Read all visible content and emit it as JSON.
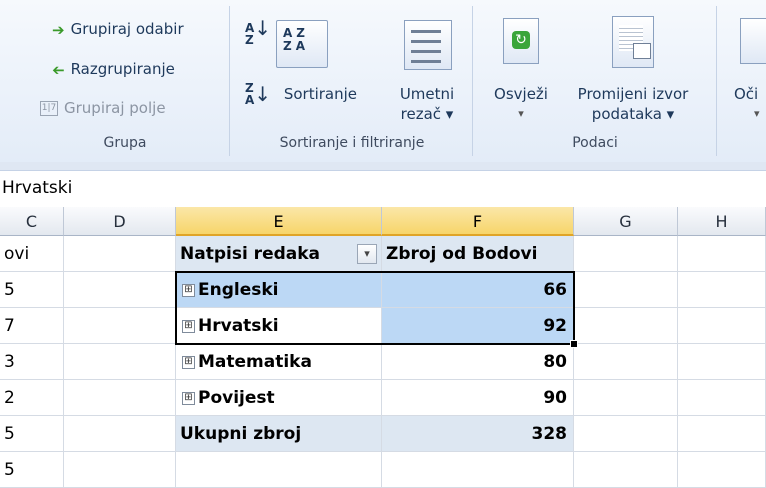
{
  "ribbon": {
    "grupa": {
      "group_selection": "Grupiraj odabir",
      "ungroup": "Razgrupiranje",
      "group_field": "Grupiraj polje",
      "label": "Grupa"
    },
    "sort": {
      "sort_label": "Sortiranje",
      "slicer_line1": "Umetni",
      "slicer_line2": "rezač ▾",
      "label": "Sortiranje i filtriranje"
    },
    "data": {
      "refresh": "Osvježi",
      "refresh_arrow": "▾",
      "change_source_line1": "Promijeni izvor",
      "change_source_line2": "podataka ▾",
      "label": "Podaci"
    },
    "partial": {
      "clear_label": "Oči",
      "clear_arrow": "▾"
    }
  },
  "formula_bar": {
    "value": "Hrvatski"
  },
  "columns": [
    "C",
    "D",
    "E",
    "F",
    "G",
    "H"
  ],
  "left_column_fragments": [
    "ovi",
    "5",
    "7",
    "3",
    "2",
    "5",
    "5"
  ],
  "pivot": {
    "header_rows": "Natpisi redaka",
    "header_values": "Zbroj od Bodovi",
    "filter_arrow": "▾",
    "expand_symbol": "⊞",
    "rows": [
      {
        "label": "Engleski",
        "value": "66"
      },
      {
        "label": "Hrvatski",
        "value": "92"
      },
      {
        "label": "Matematika",
        "value": "80"
      },
      {
        "label": "Povijest",
        "value": "90"
      }
    ],
    "total_label": "Ukupni zbroj",
    "total_value": "328"
  }
}
